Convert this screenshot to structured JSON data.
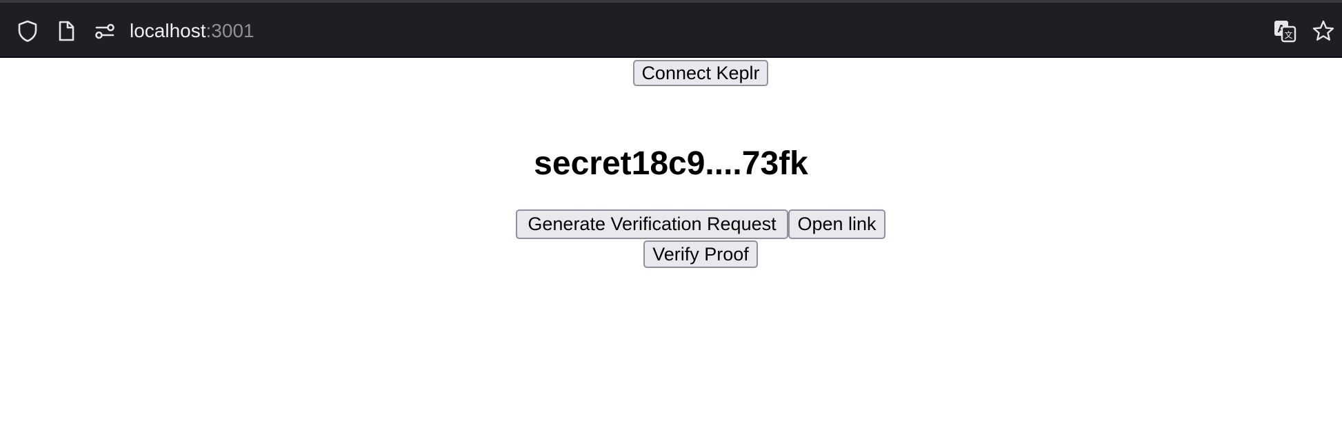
{
  "browser": {
    "url_host": "localhost",
    "url_port": ":3001",
    "icons": {
      "shield": "shield-icon",
      "page": "page-icon",
      "permissions": "permissions-icon",
      "translate": "translate-icon",
      "bookmark": "bookmark-star-icon"
    }
  },
  "page": {
    "connect_button": "Connect Keplr",
    "address": "secret18c9....73fk",
    "generate_button": "Generate Verification Request",
    "open_link_button": "Open link",
    "verify_button": "Verify Proof"
  }
}
